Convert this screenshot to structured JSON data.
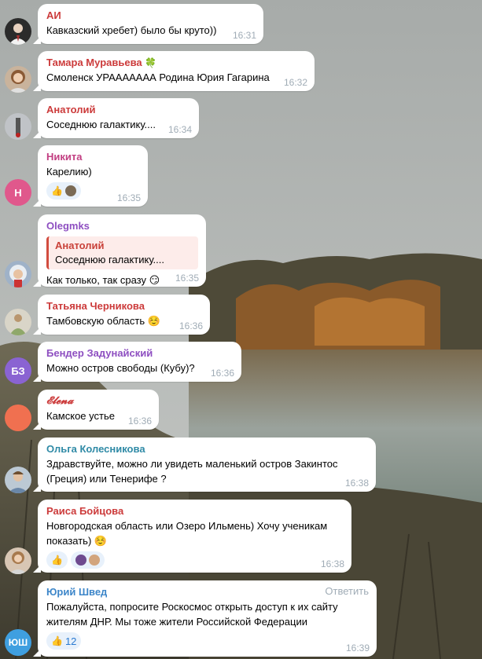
{
  "messages": [
    {
      "author": "АИ",
      "name_color": "#cc3b3b",
      "text": "Кавказский хребет) было бы круто))",
      "time": "16:31"
    },
    {
      "author": "Тамара Муравьева",
      "name_color": "#cc3b3b",
      "badge": "🍀",
      "text": "Смоленск УРААААААА  Родина Юрия Гагарина",
      "time": "16:32"
    },
    {
      "author": "Анатолий",
      "name_color": "#cc3b3b",
      "text": "Соседнюю галактику....",
      "time": "16:34"
    },
    {
      "author": "Никита",
      "name_color": "#c23f82",
      "text": "Карелию)",
      "time": "16:35",
      "avatar_initial": "Н",
      "avatar_color": "#e0588c"
    },
    {
      "author": "Olegmks",
      "name_color": "#8e4fc1",
      "quote": {
        "name": "Анатолий",
        "text": "Соседнюю галактику...."
      },
      "text": "Как только, так сразу 😏",
      "time": "16:35"
    },
    {
      "author": "Татьяна Черникова",
      "name_color": "#cc3b3b",
      "text": "Тамбовскую область ☺️",
      "time": "16:36"
    },
    {
      "author": "Бендер Задунайский",
      "name_color": "#8e4fc1",
      "text": "Можно остров свободы (Кубу)?",
      "time": "16:36",
      "avatar_initial": "БЗ",
      "avatar_color": "#8a63d2"
    },
    {
      "author": "𝓔𝓵𝓮𝓷𝓪",
      "name_color": "#cc3b3b",
      "text": "Камское устье",
      "time": "16:36",
      "avatar_color": "#f07050"
    },
    {
      "author": "Ольга Колесникова",
      "name_color": "#2f8aa6",
      "text": "Здравствуйте, можно ли увидеть маленький остров Закинтос (Греция) или Тенерифе ?",
      "time": "16:38"
    },
    {
      "author": "Раиса Бойцова",
      "name_color": "#cc3b3b",
      "text": "Новгородская область или Озеро Ильмень) Хочу ученикам показать) ☺️",
      "time": "16:38"
    },
    {
      "author": "Юрий Швед",
      "name_color": "#3d86c9",
      "reply_label": "Ответить",
      "text": "Пожалуйста, попросите Роскосмос открыть доступ к их сайту жителям ДНР. Мы тоже жители Российской Федерации",
      "time": "16:39",
      "avatar_initial": "ЮШ",
      "avatar_color": "#3f9fe0",
      "reaction_count": "12"
    }
  ]
}
